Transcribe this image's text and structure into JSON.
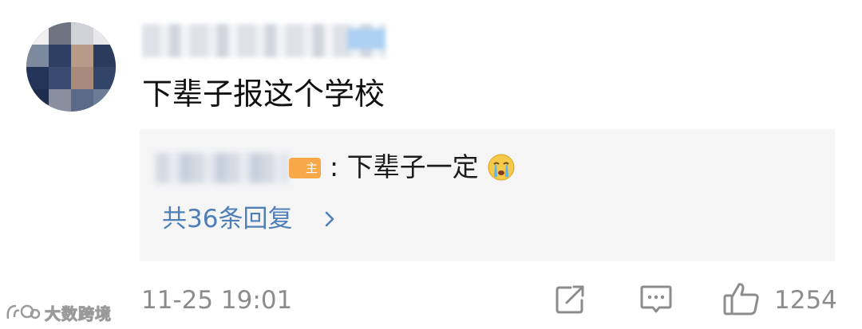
{
  "comment": {
    "text": "下辈子报这个学校",
    "timestamp": "11-25 19:01",
    "like_count": "1254"
  },
  "reply": {
    "author_badge": "主",
    "text": ": 下辈子一定",
    "emoji": "crying-face",
    "more_label": "共36条回复"
  },
  "actions": {
    "share_icon": "share-icon",
    "comment_icon": "comment-icon",
    "like_icon": "thumbs-up-icon"
  },
  "colors": {
    "link_blue": "#4f7fb6",
    "meta_gray": "#8c8c8c",
    "reply_bg": "#f5f5f6",
    "badge_orange": "#f7a94a"
  },
  "watermark": {
    "text": "大数跨境"
  }
}
